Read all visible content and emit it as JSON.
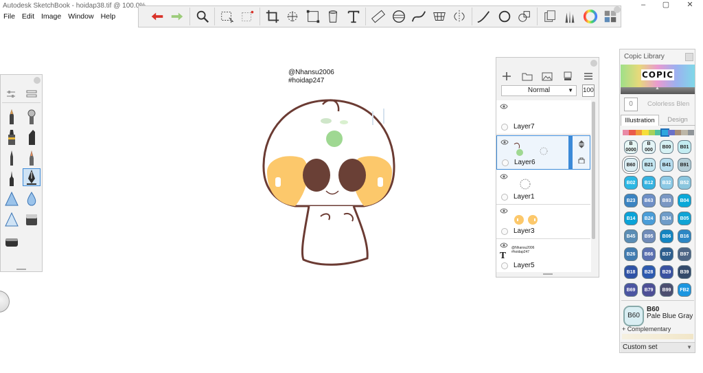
{
  "window": {
    "title": "Autodesk SketchBook - hoidap38.tif @ 100.0%",
    "minimize": "–",
    "maximize": "▢",
    "close": "✕"
  },
  "menu": [
    "File",
    "Edit",
    "Image",
    "Window",
    "Help"
  ],
  "toolbar": {
    "icons": [
      "undo-icon",
      "redo-icon",
      "zoom-icon",
      "rect-select-icon",
      "magic-select-icon",
      "crop-icon",
      "transform-icon",
      "distort-icon",
      "fill-icon",
      "text-icon",
      "ruler-icon",
      "ellipse-guide-icon",
      "french-curve-icon",
      "perspective-icon",
      "symmetry-icon",
      "stroke-icon",
      "predictive-stroke-icon",
      "shapes-icon",
      "copic-icon",
      "brush-library-icon",
      "color-wheel-icon",
      "palettes-icon"
    ]
  },
  "canvas": {
    "text_line1": "@Nhansu2006",
    "text_line2": "#hoidap247"
  },
  "layers": {
    "blend_mode": "Normal",
    "opacity": "100",
    "items": [
      {
        "name": "Layer7"
      },
      {
        "name": "Layer6"
      },
      {
        "name": "Layer1"
      },
      {
        "name": "Layer3"
      },
      {
        "name": "Layer5",
        "thumb_text_1": "@Nhansu2006",
        "thumb_text_2": "#hoidap247",
        "type_label": "T"
      }
    ]
  },
  "copic": {
    "title": "Copic Library",
    "logo": "COPIC",
    "colorless_value": "0",
    "colorless_label": "Colorless Blen",
    "tabs": [
      "Illustration",
      "Design"
    ],
    "swatches": [
      [
        "B 0000",
        "B 000",
        "B00",
        "B01"
      ],
      [
        "B60",
        "B21",
        "B41",
        "B91"
      ],
      [
        "B02",
        "B12",
        "B32",
        "B52"
      ],
      [
        "B23",
        "B63",
        "B93",
        "B04"
      ],
      [
        "B14",
        "B24",
        "B34",
        "B05"
      ],
      [
        "B45",
        "B95",
        "B06",
        "B16"
      ],
      [
        "B26",
        "B66",
        "B37",
        "B97"
      ],
      [
        "B18",
        "B28",
        "B29",
        "B39"
      ],
      [
        "B69",
        "B79",
        "B99",
        "FB2"
      ]
    ],
    "swatch_colors": [
      [
        "#e6f6f4",
        "#e4f4f6",
        "#d6f1f3",
        "#c3ecf1"
      ],
      [
        "#dbeef3",
        "#c5e7f2",
        "#b8def0",
        "#b3cdd6"
      ],
      [
        "#2bb7e4",
        "#35b2e0",
        "#8cc9e5",
        "#8bc6de"
      ],
      [
        "#3b84c2",
        "#6e8fc6",
        "#7a97c3",
        "#0aa8d8"
      ],
      [
        "#0aa3d8",
        "#4a9dd8",
        "#6f9cc8",
        "#10a4d5"
      ],
      [
        "#5a8db5",
        "#6f8ab8",
        "#1385c1",
        "#2c86c4"
      ],
      [
        "#417bb0",
        "#5b70b0",
        "#2d5e8e",
        "#4d6585"
      ],
      [
        "#2f52a6",
        "#2d5ab0",
        "#3a52a0",
        "#334a6a"
      ],
      [
        "#4b55a2",
        "#4d4f96",
        "#4c4f70",
        "#1b96e0"
      ]
    ],
    "selected_code": "B60",
    "selected_name": "Pale Blue Gray",
    "selected_swatch": "B60",
    "complementary_label": "Complementary",
    "custom_set_label": "Custom set"
  }
}
